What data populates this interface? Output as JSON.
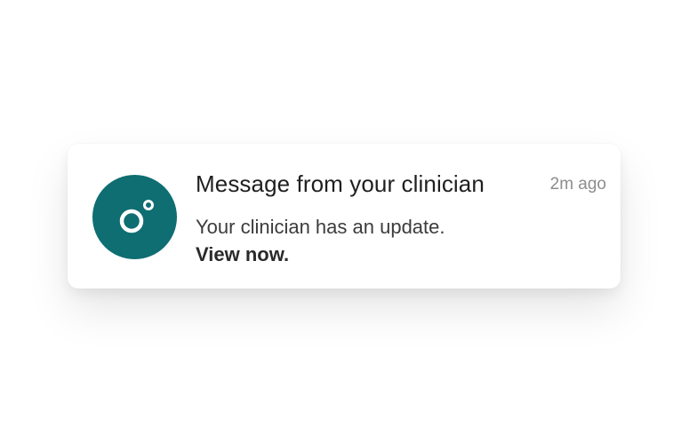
{
  "notification": {
    "icon": "app-logo-icon",
    "title": "Message from your clinician",
    "timestamp": "2m ago",
    "body": "Your clinician has an update.",
    "cta": "View now.",
    "colors": {
      "icon_background": "#0e6e72",
      "icon_foreground": "#ffffff"
    }
  }
}
